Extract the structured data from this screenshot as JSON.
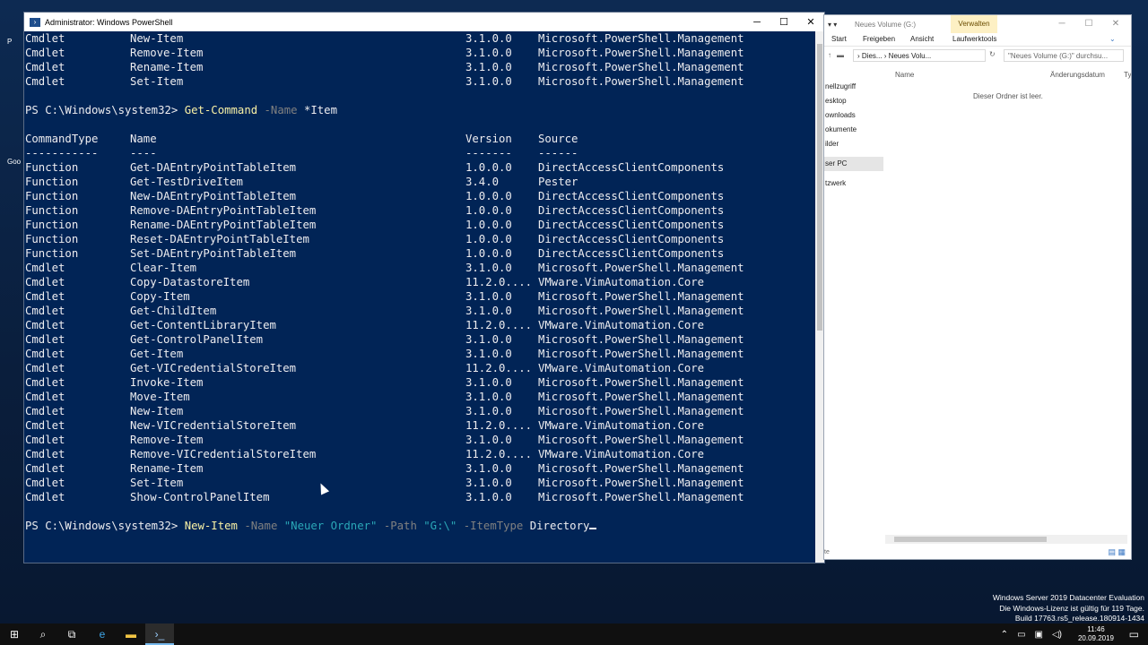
{
  "powershell": {
    "title": "Administrator: Windows PowerShell",
    "top_rows": [
      [
        "Cmdlet",
        "New-Item",
        "3.1.0.0",
        "Microsoft.PowerShell.Management"
      ],
      [
        "Cmdlet",
        "Remove-Item",
        "3.1.0.0",
        "Microsoft.PowerShell.Management"
      ],
      [
        "Cmdlet",
        "Rename-Item",
        "3.1.0.0",
        "Microsoft.PowerShell.Management"
      ],
      [
        "Cmdlet",
        "Set-Item",
        "3.1.0.0",
        "Microsoft.PowerShell.Management"
      ]
    ],
    "prompt": "PS C:\\Windows\\system32> ",
    "command1": {
      "cmd": "Get-Command",
      "param": "-Name",
      "arg": "*Item"
    },
    "headers": [
      "CommandType",
      "Name",
      "Version",
      "Source"
    ],
    "underlines": [
      "-----------",
      "----",
      "-------",
      "------"
    ],
    "rows": [
      [
        "Function",
        "Get-DAEntryPointTableItem",
        "1.0.0.0",
        "DirectAccessClientComponents"
      ],
      [
        "Function",
        "Get-TestDriveItem",
        "3.4.0",
        "Pester"
      ],
      [
        "Function",
        "New-DAEntryPointTableItem",
        "1.0.0.0",
        "DirectAccessClientComponents"
      ],
      [
        "Function",
        "Remove-DAEntryPointTableItem",
        "1.0.0.0",
        "DirectAccessClientComponents"
      ],
      [
        "Function",
        "Rename-DAEntryPointTableItem",
        "1.0.0.0",
        "DirectAccessClientComponents"
      ],
      [
        "Function",
        "Reset-DAEntryPointTableItem",
        "1.0.0.0",
        "DirectAccessClientComponents"
      ],
      [
        "Function",
        "Set-DAEntryPointTableItem",
        "1.0.0.0",
        "DirectAccessClientComponents"
      ],
      [
        "Cmdlet",
        "Clear-Item",
        "3.1.0.0",
        "Microsoft.PowerShell.Management"
      ],
      [
        "Cmdlet",
        "Copy-DatastoreItem",
        "11.2.0....",
        "VMware.VimAutomation.Core"
      ],
      [
        "Cmdlet",
        "Copy-Item",
        "3.1.0.0",
        "Microsoft.PowerShell.Management"
      ],
      [
        "Cmdlet",
        "Get-ChildItem",
        "3.1.0.0",
        "Microsoft.PowerShell.Management"
      ],
      [
        "Cmdlet",
        "Get-ContentLibraryItem",
        "11.2.0....",
        "VMware.VimAutomation.Core"
      ],
      [
        "Cmdlet",
        "Get-ControlPanelItem",
        "3.1.0.0",
        "Microsoft.PowerShell.Management"
      ],
      [
        "Cmdlet",
        "Get-Item",
        "3.1.0.0",
        "Microsoft.PowerShell.Management"
      ],
      [
        "Cmdlet",
        "Get-VICredentialStoreItem",
        "11.2.0....",
        "VMware.VimAutomation.Core"
      ],
      [
        "Cmdlet",
        "Invoke-Item",
        "3.1.0.0",
        "Microsoft.PowerShell.Management"
      ],
      [
        "Cmdlet",
        "Move-Item",
        "3.1.0.0",
        "Microsoft.PowerShell.Management"
      ],
      [
        "Cmdlet",
        "New-Item",
        "3.1.0.0",
        "Microsoft.PowerShell.Management"
      ],
      [
        "Cmdlet",
        "New-VICredentialStoreItem",
        "11.2.0....",
        "VMware.VimAutomation.Core"
      ],
      [
        "Cmdlet",
        "Remove-Item",
        "3.1.0.0",
        "Microsoft.PowerShell.Management"
      ],
      [
        "Cmdlet",
        "Remove-VICredentialStoreItem",
        "11.2.0....",
        "VMware.VimAutomation.Core"
      ],
      [
        "Cmdlet",
        "Rename-Item",
        "3.1.0.0",
        "Microsoft.PowerShell.Management"
      ],
      [
        "Cmdlet",
        "Set-Item",
        "3.1.0.0",
        "Microsoft.PowerShell.Management"
      ],
      [
        "Cmdlet",
        "Show-ControlPanelItem",
        "3.1.0.0",
        "Microsoft.PowerShell.Management"
      ]
    ],
    "command2": {
      "cmd": "New-Item",
      "p1": "-Name",
      "v1": "\"Neuer Ordner\"",
      "p2": "-Path",
      "v2": "\"G:\\\"",
      "p3": "-ItemType",
      "v3": "Directory"
    }
  },
  "explorer": {
    "title": "Neues Volume (G:)",
    "context_tab": "Verwalten",
    "ribbon_tabs": [
      "Start",
      "Freigeben",
      "Ansicht",
      "Laufwerktools"
    ],
    "path_segments": [
      "Dies...",
      "Neues Volu..."
    ],
    "search_placeholder": "\"Neues Volume (G:)\" durchsu...",
    "nav_items": [
      "nellzugriff",
      "esktop",
      "ownloads",
      "okumente",
      "ilder",
      "ser PC",
      "tzwerk"
    ],
    "columns": [
      "Name",
      "Änderungsdatum",
      "Ty"
    ],
    "empty_message": "Dieser Ordner ist leer.",
    "status_fragment": "te"
  },
  "desktop_icons": [
    "P",
    "Goo"
  ],
  "watermark": [
    "Windows Server 2019 Datacenter Evaluation",
    "Die Windows-Lizenz ist gültig für 119 Tage.",
    "Build 17763.rs5_release.180914-1434"
  ],
  "taskbar": {
    "time": "11:46",
    "date": "20.09.2019"
  },
  "colors": {
    "ps_background": "#012456",
    "ps_cmd": "#f9f1a5",
    "ps_param": "#808080",
    "ps_string": "#2aa7b7",
    "explorer_context": "#fdf0c4"
  }
}
